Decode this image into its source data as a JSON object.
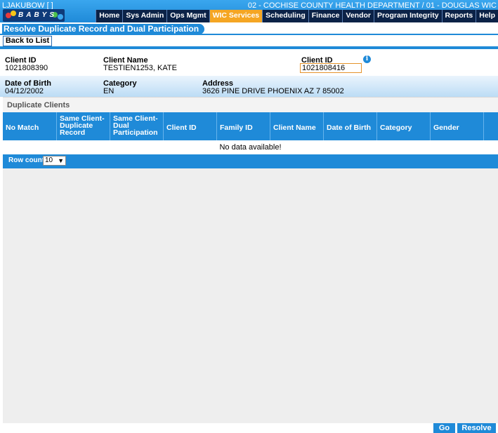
{
  "header": {
    "user": "LJAKUBOW [ ]",
    "department": "02 - COCHISE COUNTY HEALTH DEPARTMENT / 01 - DOUGLAS WIC",
    "logo_icon": "babys-logo-icon",
    "nav": [
      {
        "label": "Home",
        "active": false
      },
      {
        "label": "Sys Admin",
        "active": false
      },
      {
        "label": "Ops Mgmt",
        "active": false
      },
      {
        "label": "WIC Services",
        "active": true
      },
      {
        "label": "Scheduling",
        "active": false
      },
      {
        "label": "Finance",
        "active": false
      },
      {
        "label": "Vendor",
        "active": false
      },
      {
        "label": "Program Integrity",
        "active": false
      },
      {
        "label": "Reports",
        "active": false
      },
      {
        "label": "Help",
        "active": false
      }
    ]
  },
  "page": {
    "title": "Resolve Duplicate Record and Dual Participation",
    "back_label": "Back to List"
  },
  "client": {
    "id_label": "Client ID",
    "id_value": "1021808390",
    "name_label": "Client Name",
    "name_value": "TESTIEN1253, KATE",
    "lookup_label": "Client ID",
    "lookup_value": "1021808416",
    "dob_label": "Date of Birth",
    "dob_value": "04/12/2002",
    "category_label": "Category",
    "category_value": "EN",
    "address_label": "Address",
    "address_value": "3626 PINE DRIVE PHOENIX AZ 7 85002"
  },
  "duplicates": {
    "section_title": "Duplicate Clients",
    "columns": [
      "No Match",
      "Same Client-Duplicate Record",
      "Same Client-Dual Participation",
      "Client ID",
      "Family ID",
      "Client Name",
      "Date of Birth",
      "Category",
      "Gender"
    ],
    "empty_message": "No data available!",
    "row_count_label": "Row count:",
    "row_count_value": "10"
  },
  "actions": {
    "go_label": "Go",
    "resolve_label": "Resolve"
  },
  "colors": {
    "primary": "#1f8ad8",
    "active_tab": "#f5a623",
    "nav_bg": "#0b2247"
  }
}
